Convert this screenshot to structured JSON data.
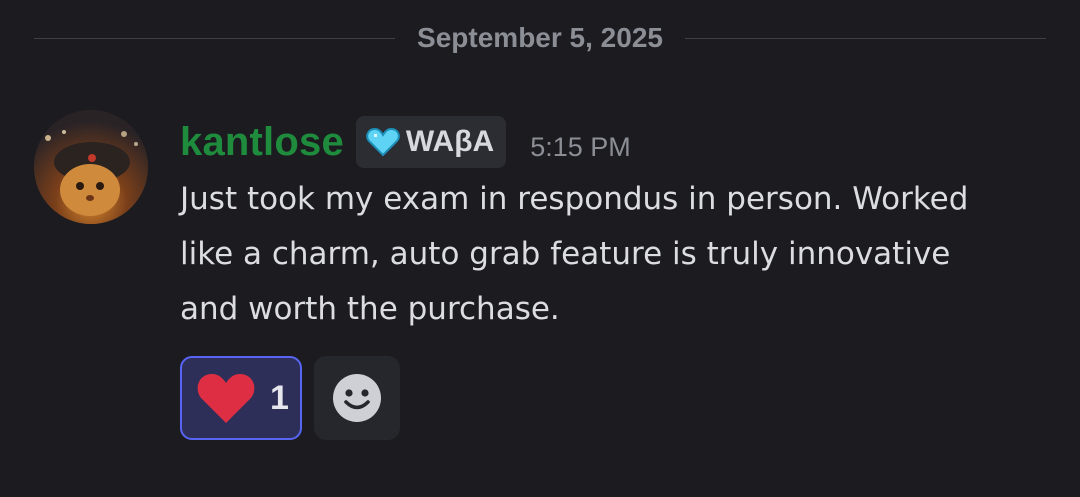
{
  "divider": {
    "date": "September 5, 2025"
  },
  "message": {
    "author": "kantlose",
    "author_color": "#1f8b3c",
    "tag": {
      "icon": "blue-heart-icon",
      "label": "WAβA"
    },
    "timestamp": "5:15 PM",
    "avatar": "avatar-cat-in-hat",
    "text_lines": [
      "Just took my exam in respondus in person. Worked",
      "like a charm, auto grab feature is truly innovative",
      "and worth the purchase."
    ]
  },
  "reactions": [
    {
      "emoji": "red-heart-icon",
      "count": "1",
      "selected": true,
      "accent": "#5865f2"
    }
  ],
  "add_reaction": {
    "icon": "smiley-face-icon"
  }
}
